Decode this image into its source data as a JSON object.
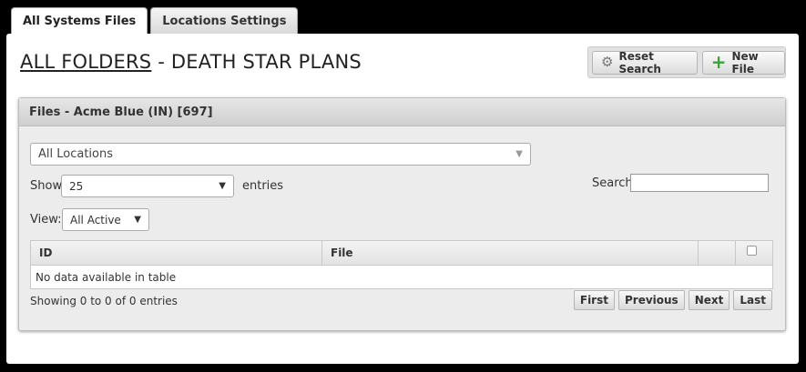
{
  "tabs": [
    {
      "label": "All Systems Files",
      "active": true
    },
    {
      "label": "Locations Settings",
      "active": false
    }
  ],
  "header": {
    "title_link": "ALL FOLDERS",
    "title_rest": " - DEATH STAR PLANS"
  },
  "toolbar": {
    "reset_label": "Reset Search",
    "reset_icon": "gear-icon",
    "new_label": "New File",
    "new_icon": "plus-icon"
  },
  "files_panel": {
    "title": "Files - Acme Blue (IN) [697]",
    "location_select": "All Locations",
    "show_label": "Show",
    "entries_value": "25",
    "entries_label": "entries",
    "search_label": "Search:",
    "search_value": "",
    "view_label": "View:",
    "view_value": "All Active"
  },
  "table": {
    "columns": [
      "ID",
      "File",
      "",
      ""
    ],
    "empty_message": "No data available in table"
  },
  "footer": {
    "info": "Showing 0 to 0 of 0 entries",
    "pager": [
      "First",
      "Previous",
      "Next",
      "Last"
    ]
  },
  "colors": {
    "plus_icon": "#3aa33a",
    "page_background": "#000000"
  }
}
